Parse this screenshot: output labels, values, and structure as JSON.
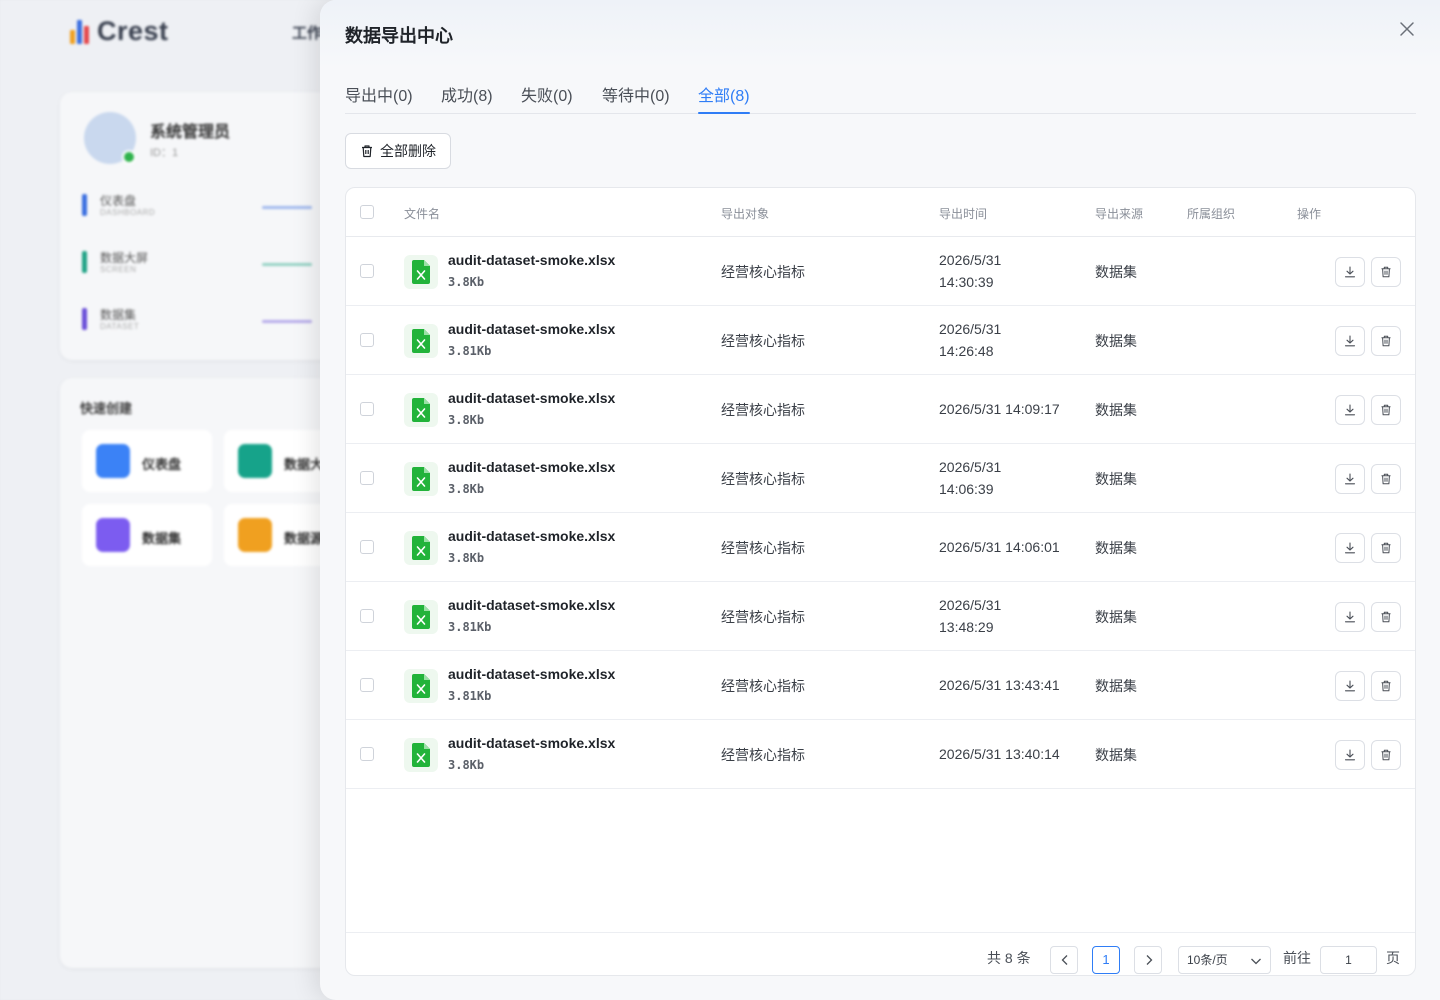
{
  "background": {
    "logo_text": "Crest",
    "nav_text": "工作",
    "profile": {
      "name": "系统管理员",
      "id_text": "ID：1",
      "stats": [
        {
          "label": "仪表盘",
          "sub": "DASHBOARD",
          "color": "#3b6fe0"
        },
        {
          "label": "数据大屏",
          "sub": "SCREEN",
          "color": "#20a386"
        },
        {
          "label": "数据集",
          "sub": "DATASET",
          "color": "#6a4fd8"
        }
      ]
    },
    "quick": {
      "title": "快速创建",
      "tiles": [
        {
          "label": "仪表盘",
          "color": "#3b82f6"
        },
        {
          "label": "数据大",
          "color": "#16a38a"
        },
        {
          "label": "数据集",
          "color": "#7c5cf0"
        },
        {
          "label": "数据源",
          "color": "#f0a020"
        }
      ]
    }
  },
  "drawer": {
    "title": "数据导出中心",
    "tabs": [
      {
        "label": "导出中(0)",
        "active": false
      },
      {
        "label": "成功(8)",
        "active": false
      },
      {
        "label": "失败(0)",
        "active": false
      },
      {
        "label": "等待中(0)",
        "active": false
      },
      {
        "label": "全部(8)",
        "active": true
      }
    ],
    "delete_all_label": "全部删除",
    "columns": [
      "文件名",
      "导出对象",
      "导出时间",
      "导出来源",
      "所属组织",
      "操作"
    ],
    "rows": [
      {
        "file": "audit-dataset-smoke.xlsx",
        "size": "3.8Kb",
        "object": "经营核心指标",
        "time": "2026/5/31 14:30:39",
        "time_wrap": true,
        "source": "数据集",
        "org": ""
      },
      {
        "file": "audit-dataset-smoke.xlsx",
        "size": "3.81Kb",
        "object": "经营核心指标",
        "time": "2026/5/31 14:26:48",
        "time_wrap": true,
        "source": "数据集",
        "org": ""
      },
      {
        "file": "audit-dataset-smoke.xlsx",
        "size": "3.8Kb",
        "object": "经营核心指标",
        "time": "2026/5/31 14:09:17",
        "time_wrap": false,
        "source": "数据集",
        "org": ""
      },
      {
        "file": "audit-dataset-smoke.xlsx",
        "size": "3.8Kb",
        "object": "经营核心指标",
        "time": "2026/5/31 14:06:39",
        "time_wrap": true,
        "source": "数据集",
        "org": ""
      },
      {
        "file": "audit-dataset-smoke.xlsx",
        "size": "3.8Kb",
        "object": "经营核心指标",
        "time": "2026/5/31 14:06:01",
        "time_wrap": false,
        "source": "数据集",
        "org": ""
      },
      {
        "file": "audit-dataset-smoke.xlsx",
        "size": "3.81Kb",
        "object": "经营核心指标",
        "time": "2026/5/31 13:48:29",
        "time_wrap": true,
        "source": "数据集",
        "org": ""
      },
      {
        "file": "audit-dataset-smoke.xlsx",
        "size": "3.81Kb",
        "object": "经营核心指标",
        "time": "2026/5/31 13:43:41",
        "time_wrap": false,
        "source": "数据集",
        "org": ""
      },
      {
        "file": "audit-dataset-smoke.xlsx",
        "size": "3.8Kb",
        "object": "经营核心指标",
        "time": "2026/5/31 13:40:14",
        "time_wrap": false,
        "source": "数据集",
        "org": ""
      }
    ],
    "pagination": {
      "total_text": "共 8 条",
      "current_page": "1",
      "page_size": "10条/页",
      "goto_label": "前往",
      "goto_value": "1",
      "page_suffix": "页"
    }
  },
  "colors": {
    "accent": "#2f7df6",
    "excel_green": "#22b33a"
  }
}
